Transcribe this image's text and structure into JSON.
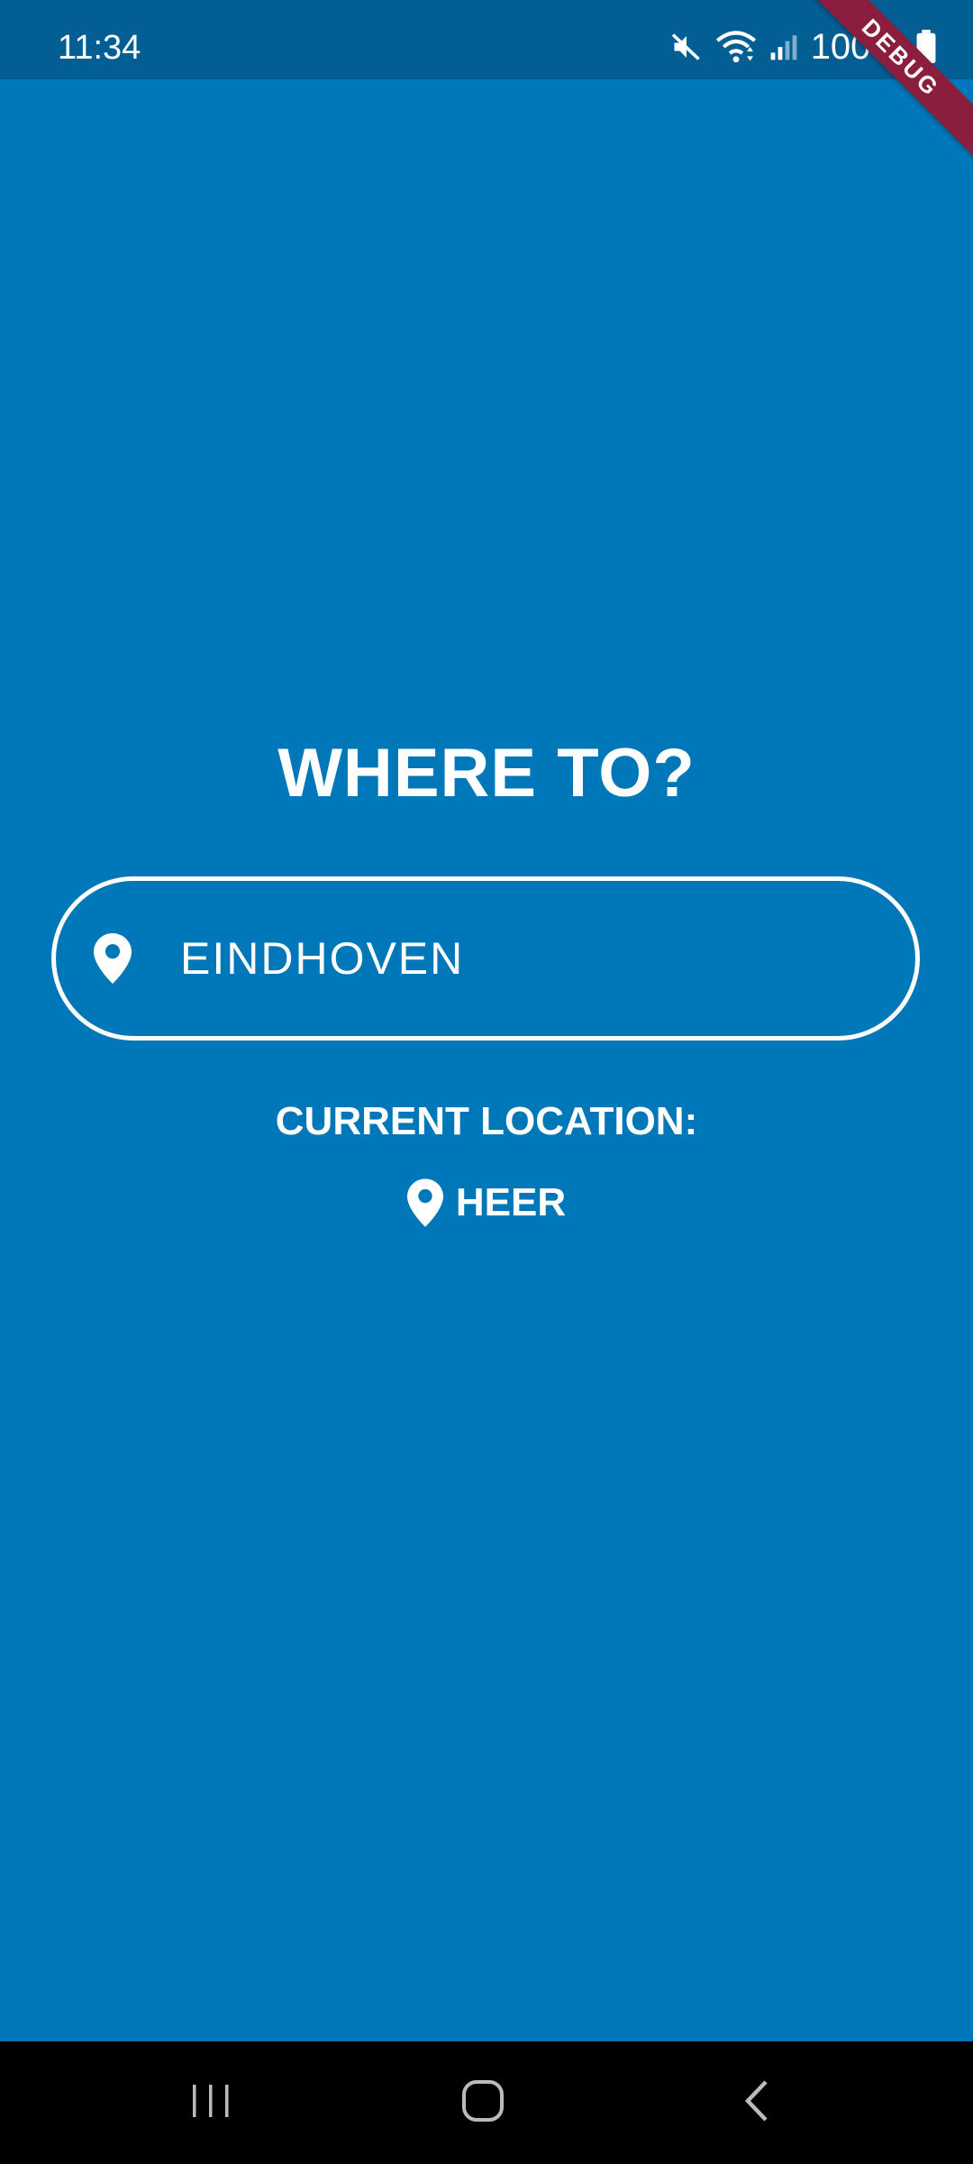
{
  "status_bar": {
    "time": "11:34",
    "battery": "100%",
    "icons": [
      "mute-icon",
      "wifi-icon",
      "signal-icon",
      "battery-icon"
    ]
  },
  "debug_banner": {
    "label": "DEBUG"
  },
  "main": {
    "title": "WHERE TO?",
    "destination_input": {
      "value": "EINDHOVEN",
      "icon": "location-pin-icon"
    },
    "current_location_label": "CURRENT LOCATION:",
    "current_location_value": "HEER",
    "current_location_icon": "location-pin-icon"
  },
  "nav_bar": {
    "buttons": [
      "recents-icon",
      "home-icon",
      "back-icon"
    ]
  },
  "colors": {
    "background": "#0077B8",
    "status_bar": "#035E94",
    "foreground": "#FFFFFF",
    "debug_ribbon": "#8B1E3F"
  }
}
